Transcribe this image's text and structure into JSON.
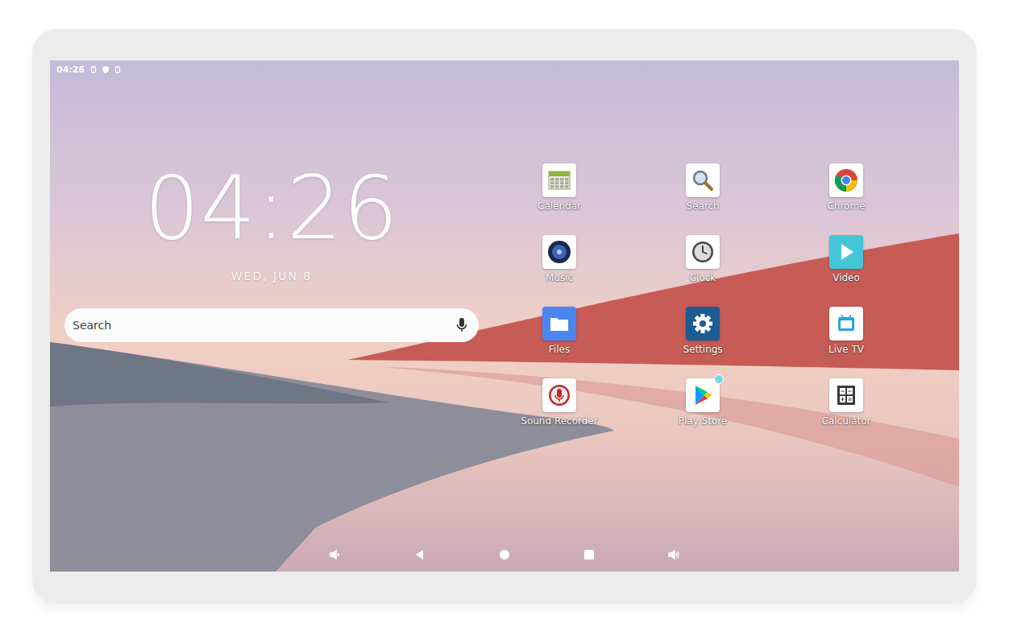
{
  "status_bar": {
    "time": "04:26"
  },
  "clock": {
    "time": "04:26",
    "date": "WED, JUN 8"
  },
  "search": {
    "placeholder": "Search"
  },
  "apps": [
    {
      "label": "Calendar",
      "badge": false
    },
    {
      "label": "Search",
      "badge": false
    },
    {
      "label": "Chrome",
      "badge": false
    },
    {
      "label": "Music",
      "badge": false
    },
    {
      "label": "Clock",
      "badge": false
    },
    {
      "label": "Video",
      "badge": false
    },
    {
      "label": "Files",
      "badge": false
    },
    {
      "label": "Settings",
      "badge": false
    },
    {
      "label": "Live TV",
      "badge": false
    },
    {
      "label": "Sound Recorder",
      "badge": false
    },
    {
      "label": "Play Store",
      "badge": true
    },
    {
      "label": "Calculator",
      "badge": false
    }
  ]
}
